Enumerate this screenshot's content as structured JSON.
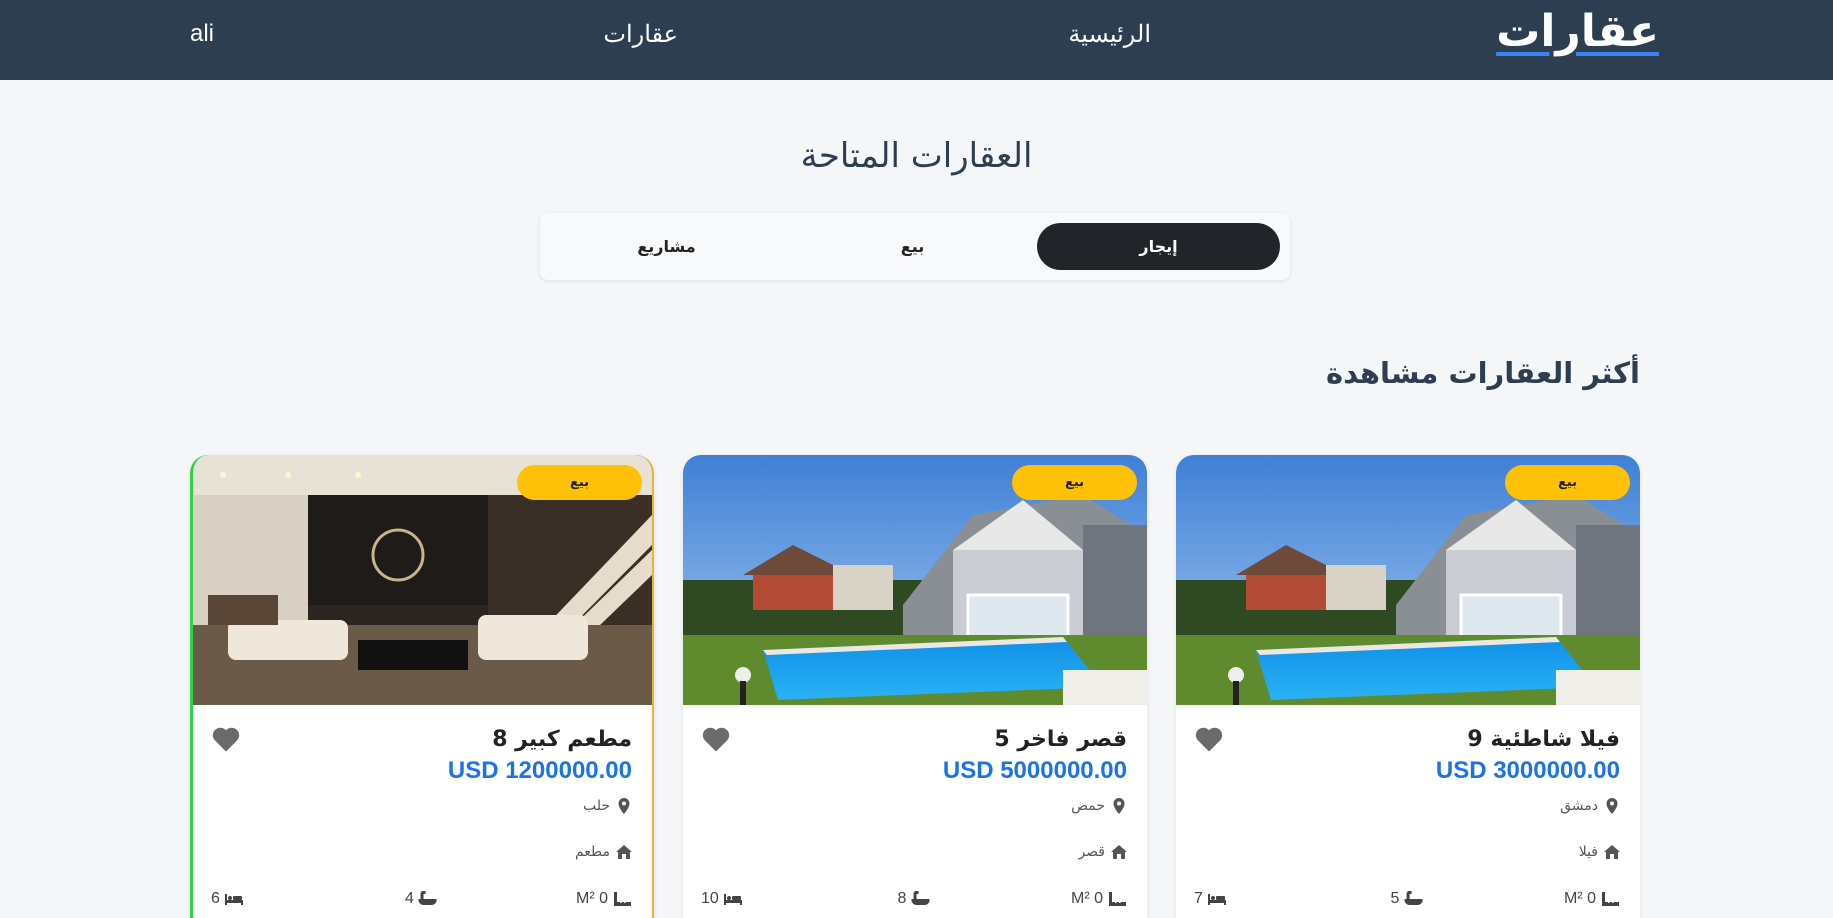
{
  "navbar": {
    "brand": "عقارات",
    "home": "الرئيسية",
    "estates": "عقارات",
    "user": "ali"
  },
  "page_title": "العقارات المتاحة",
  "tabs": [
    {
      "label": "إيجار",
      "active": true
    },
    {
      "label": "بيع",
      "active": false
    },
    {
      "label": "مشاريع",
      "active": false
    }
  ],
  "section_title": "أكثر العقارات مشاهدة",
  "cards": [
    {
      "badge": "بيع",
      "title": "فيلا شاطئية 9",
      "price": "USD 3000000.00",
      "location": "دمشق",
      "type": "فيلا",
      "area": "M² 0",
      "bathrooms": "5",
      "bedrooms": "7",
      "image": "villa-pool"
    },
    {
      "badge": "بيع",
      "title": "قصر فاخر 5",
      "price": "USD 5000000.00",
      "location": "حمص",
      "type": "قصر",
      "area": "M² 0",
      "bathrooms": "8",
      "bedrooms": "10",
      "image": "villa-pool"
    },
    {
      "badge": "بيع",
      "title": "مطعم كبير 8",
      "price": "USD 1200000.00",
      "location": "حلب",
      "type": "مطعم",
      "area": "M² 0",
      "bathrooms": "4",
      "bedrooms": "6",
      "image": "luxury-interior"
    }
  ],
  "colors": {
    "navbar_bg": "#2c3e50",
    "badge": "#ffc107",
    "price": "#1a73e8",
    "active_tab": "#212529"
  }
}
